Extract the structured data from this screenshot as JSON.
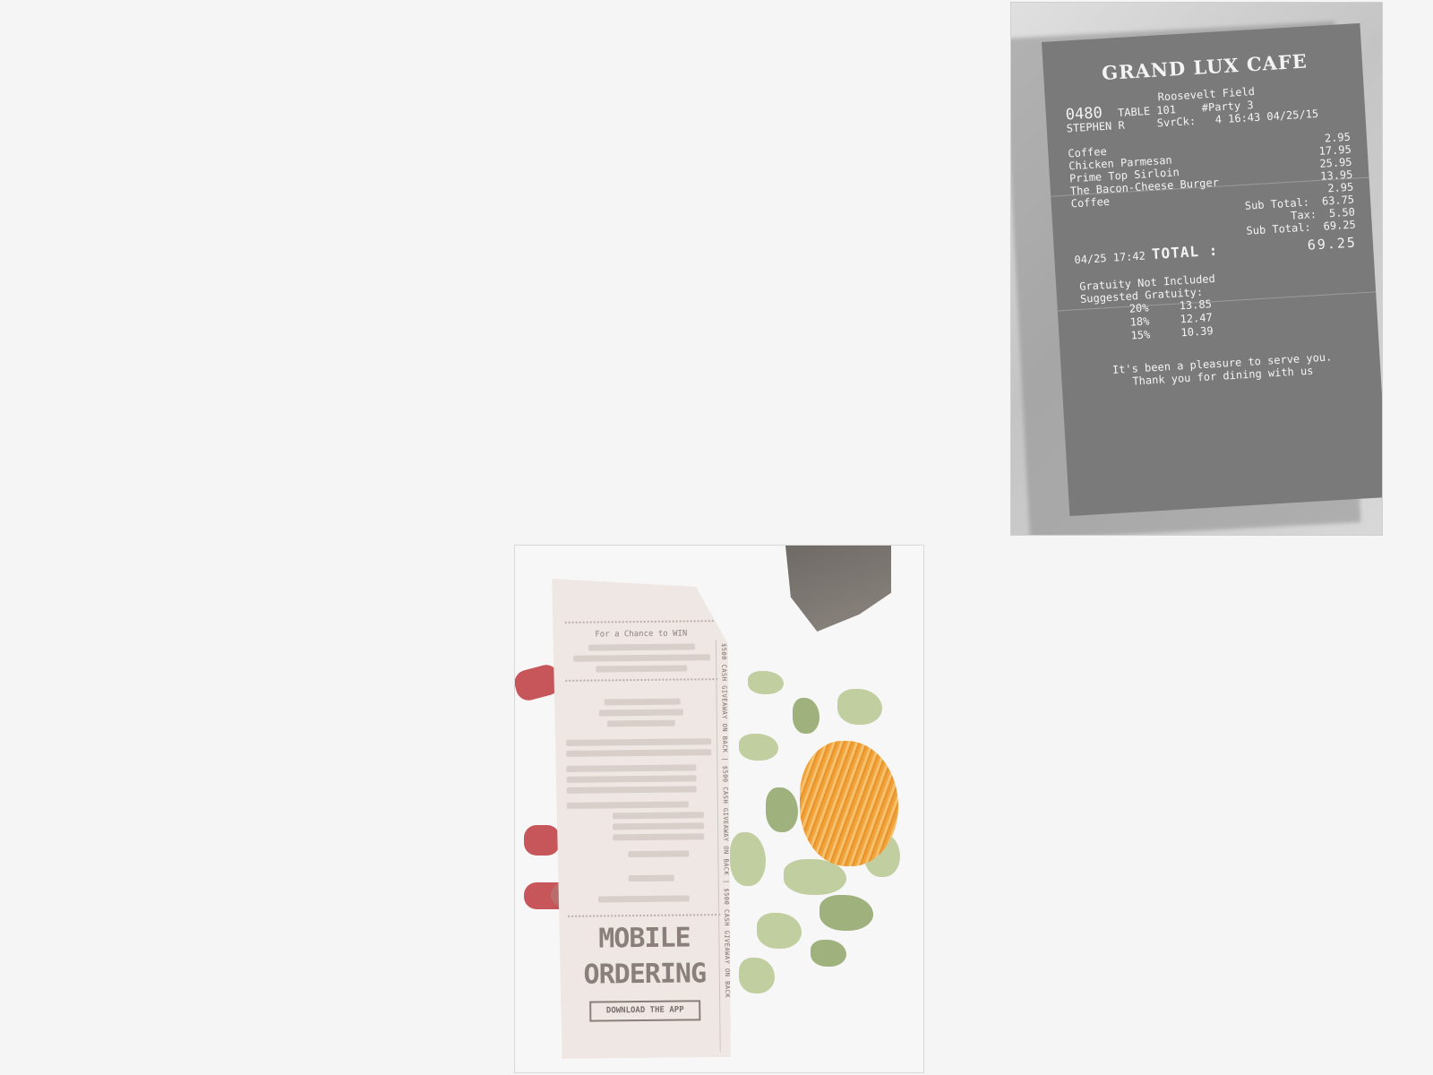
{
  "receipt1": {
    "brand": "GRAND LUX CAFE",
    "location": "Roosevelt Field",
    "store": "0480",
    "table": "TABLE 101",
    "party": "#Party 3",
    "server": "STEPHEN R",
    "svrck": "SvrCk:",
    "svrck_time": "4 16:43 04/25/15",
    "items": [
      {
        "name": "Coffee",
        "price": "2.95"
      },
      {
        "name": "Chicken Parmesan",
        "price": "17.95"
      },
      {
        "name": "Prime Top Sirloin",
        "price": "25.95"
      },
      {
        "name": "The Bacon-Cheese Burger",
        "price": "13.95"
      },
      {
        "name": "Coffee",
        "price": "2.95"
      }
    ],
    "subtotal_label": "Sub Total:",
    "subtotal": "63.75",
    "tax_label": "Tax:",
    "tax": "5.50",
    "subtotal2_label": "Sub Total:",
    "subtotal2": "69.25",
    "close_time": "04/25 17:42",
    "total_label": "TOTAL :",
    "total": "69.25",
    "gratuity_note": "Gratuity Not Included",
    "suggested_label": "Suggested Gratuity:",
    "gratuity": [
      {
        "pct": "20%",
        "amt": "13.85"
      },
      {
        "pct": "18%",
        "amt": "12.47"
      },
      {
        "pct": "15%",
        "amt": "10.39"
      }
    ],
    "thanks1": "It's been a pleasure to serve you.",
    "thanks2": "Thank you for dining with us"
  },
  "receipt2": {
    "header1": "For a Chance to WIN",
    "strip_text": "$500 CASH GIVEAWAY ON BACK | $500 CASH GIVEAWAY ON BACK | $500 CASH GIVEAWAY ON BACK",
    "promo1": "MOBILE",
    "promo2": "ORDERING",
    "cta": "DOWNLOAD THE APP"
  }
}
